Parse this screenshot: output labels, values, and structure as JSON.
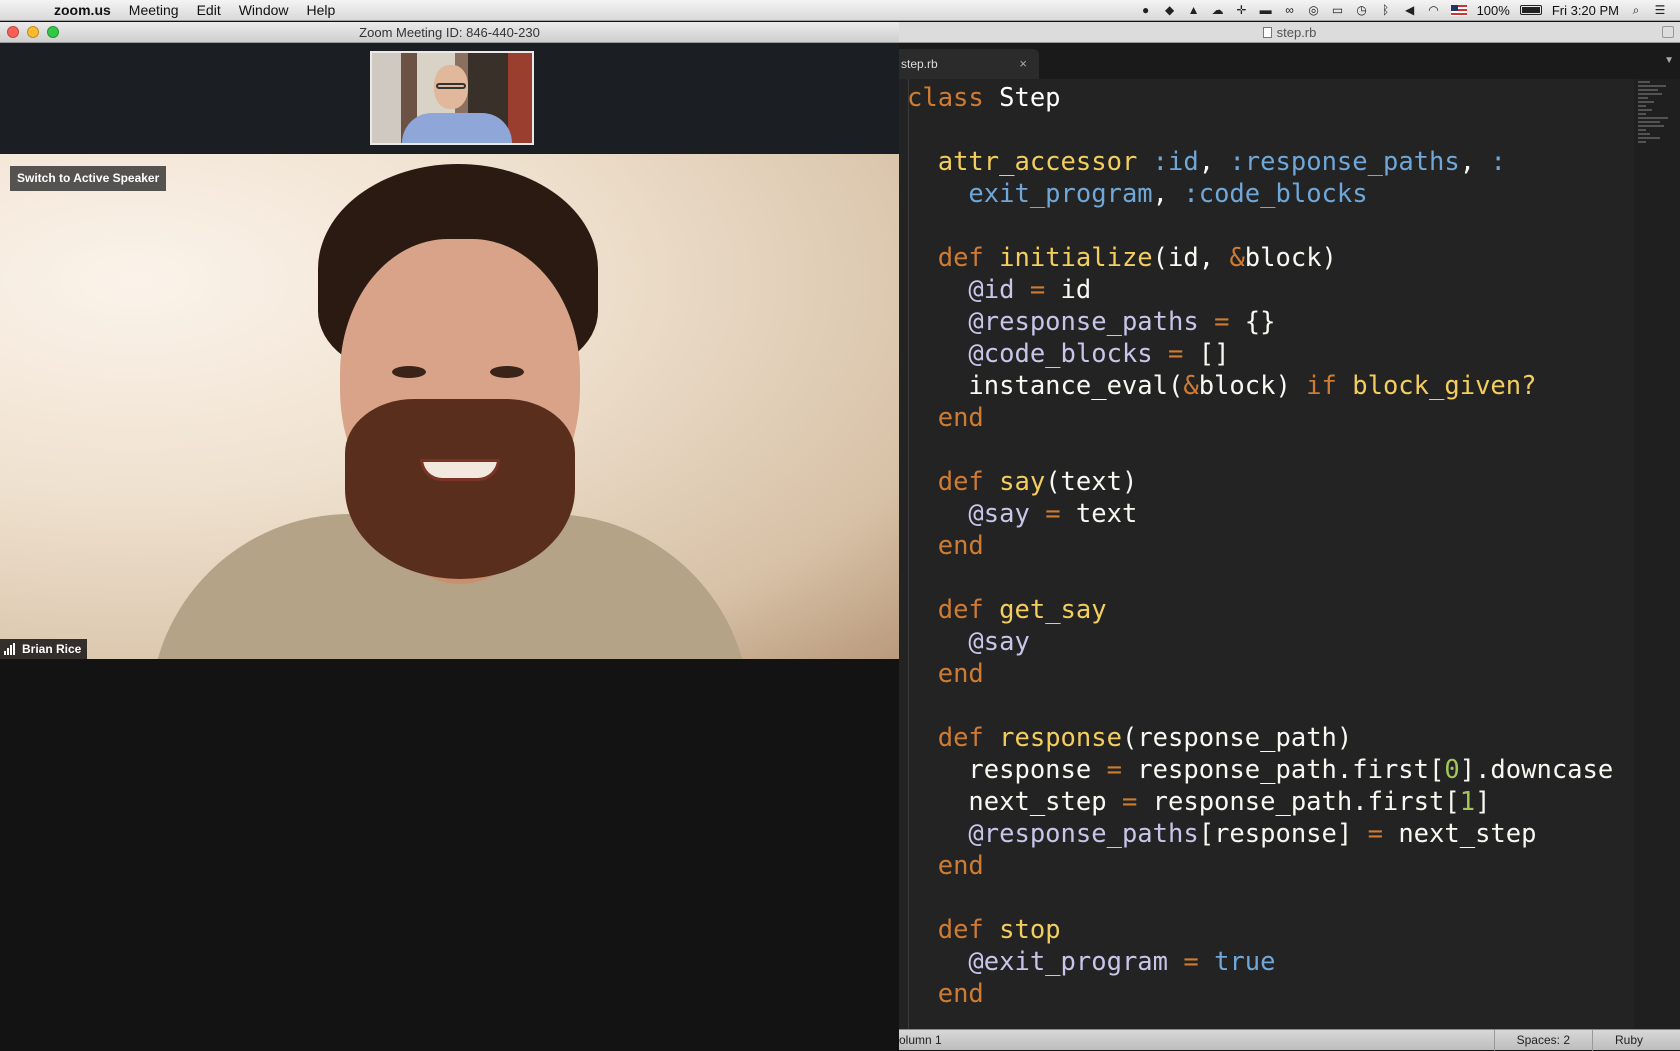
{
  "menubar": {
    "app_name": "zoom.us",
    "menus": [
      "Meeting",
      "Edit",
      "Window",
      "Help"
    ],
    "battery": "100%",
    "clock": "Fri 3:20 PM"
  },
  "zoom": {
    "window_title": "Zoom Meeting ID: 846-440-230",
    "switch_label": "Switch to Active Speaker",
    "speaker_name": "Brian Rice"
  },
  "editor": {
    "window_title": "step.rb",
    "tab_label": "step.rb",
    "tab_close": "×",
    "status_position": "olumn 1",
    "status_spaces": "Spaces: 2",
    "status_syntax": "Ruby"
  }
}
